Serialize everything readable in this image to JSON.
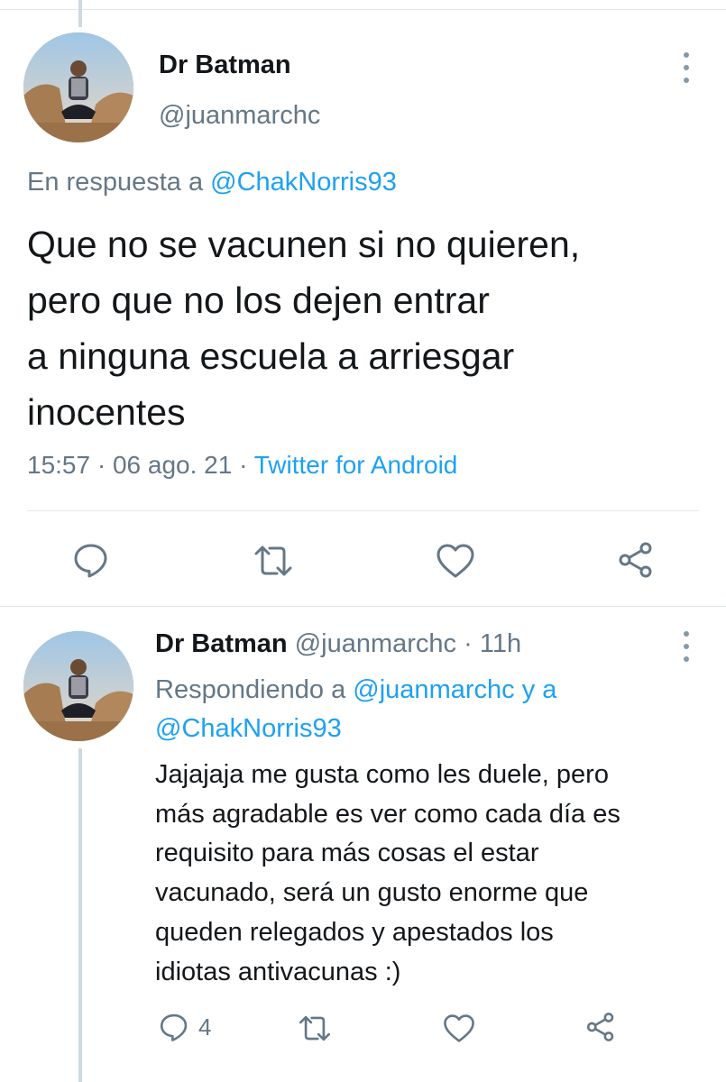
{
  "tweet": {
    "author_name": "Dr Batman",
    "author_handle": "@juanmarchc",
    "reply_prefix": "En respuesta a",
    "reply_to": "@ChakNorris93",
    "text_lines": [
      "Que no se vacunen si no quieren,",
      "pero que no los dejen entrar",
      "a ninguna escuela a arriesgar",
      "inocentes"
    ],
    "time": "15:57",
    "date": "06 ago. 21",
    "separator": "·",
    "source": "Twitter for Android",
    "actions": [
      "reply-icon",
      "retweet-icon",
      "like-icon",
      "share-icon"
    ]
  },
  "reply": {
    "author_name": "Dr Batman",
    "author_handle": "@juanmarchc",
    "separator": "·",
    "age": "11h",
    "replying_prefix": "Respondiendo a",
    "replying_to_1": "@juanmarchc",
    "replying_join": "y a",
    "replying_to_2": "@ChakNorris93",
    "text_lines": [
      "Jajajaja me gusta como les duele, pero",
      "más agradable es ver como cada día es",
      "requisito para más cosas el estar",
      "vacunado, será un gusto enorme que",
      "queden relegados y apestados los",
      "idiotas antivacunas :)"
    ],
    "reply_count": "4"
  },
  "colors": {
    "link": "#1da1f2",
    "muted": "#657786",
    "icon": "#657786",
    "divider": "#e1e8ed",
    "thread_line": "#cfd9de"
  }
}
